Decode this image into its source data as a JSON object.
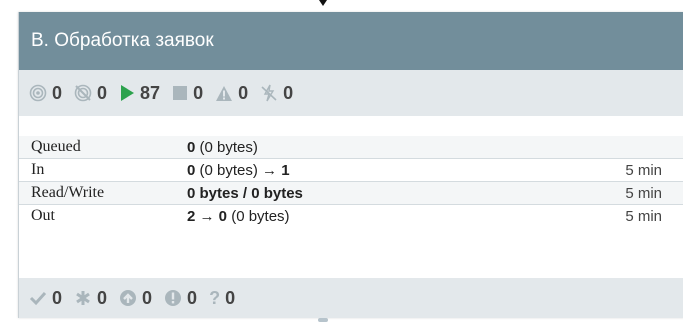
{
  "header": {
    "title": "В. Обработка заявок"
  },
  "stats": [
    {
      "icon": "transmitting-icon",
      "value": "0"
    },
    {
      "icon": "not-transmitting-icon",
      "value": "0"
    },
    {
      "icon": "running-icon",
      "value": "87"
    },
    {
      "icon": "stopped-icon",
      "value": "0"
    },
    {
      "icon": "invalid-icon",
      "value": "0"
    },
    {
      "icon": "disabled-icon",
      "value": "0"
    }
  ],
  "rows": [
    {
      "label": "Queued",
      "strong": "0",
      "rest": " (0 bytes)",
      "strong2": "",
      "age": ""
    },
    {
      "label": "In",
      "strong": "0",
      "rest": " (0 bytes) → ",
      "strong2": "1",
      "age": "5 min"
    },
    {
      "label": "Read/Write",
      "strong": "0 bytes / 0 bytes",
      "rest": "",
      "strong2": "",
      "age": "5 min"
    },
    {
      "label": "Out",
      "strong": "2 → 0",
      "rest": " (0 bytes)",
      "strong2": "",
      "age": "5 min"
    }
  ],
  "footer": [
    {
      "icon": "up-to-date-icon",
      "value": "0"
    },
    {
      "icon": "locally-modified-icon",
      "value": "0"
    },
    {
      "icon": "stale-icon",
      "value": "0"
    },
    {
      "icon": "sync-failure-icon",
      "value": "0"
    },
    {
      "icon": "unknown-icon",
      "value": "0"
    }
  ],
  "colors": {
    "header": "#728e9b",
    "stats_bg": "#e3e8eb",
    "running": "#2ca24d",
    "muted_icon": "#aab6bc"
  }
}
